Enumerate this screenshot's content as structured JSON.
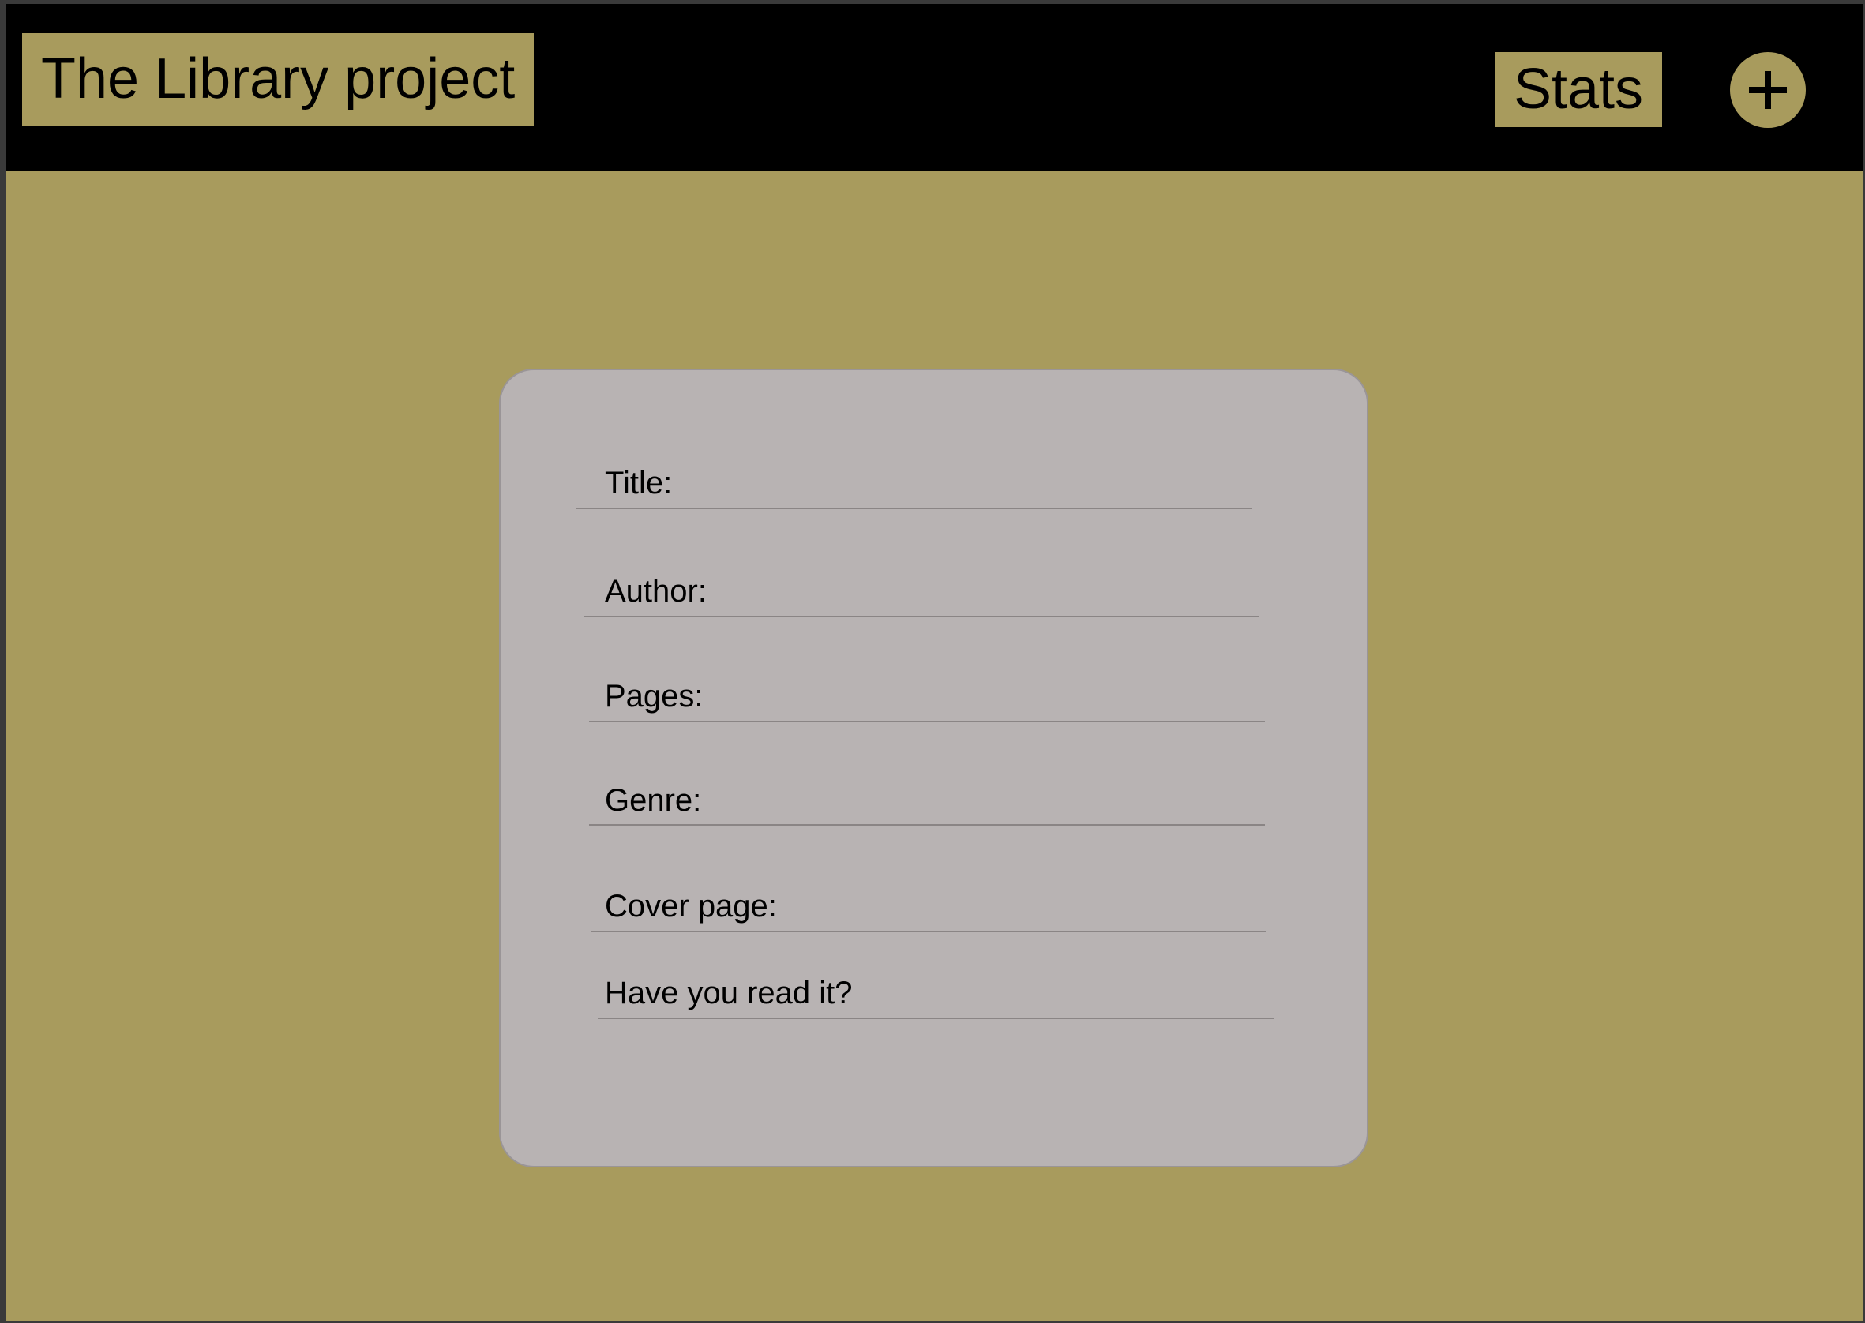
{
  "header": {
    "title": "The Library project",
    "stats_label": "Stats",
    "add_icon": "plus-icon"
  },
  "form": {
    "fields": [
      {
        "label": "Title:"
      },
      {
        "label": "Author:"
      },
      {
        "label": "Pages:"
      },
      {
        "label": "Genre:"
      },
      {
        "label": "Cover page:"
      },
      {
        "label": "Have you read it?"
      }
    ]
  },
  "colors": {
    "accent": "#a89b5d",
    "topbar": "#000000",
    "card": "#b8b3b3"
  }
}
